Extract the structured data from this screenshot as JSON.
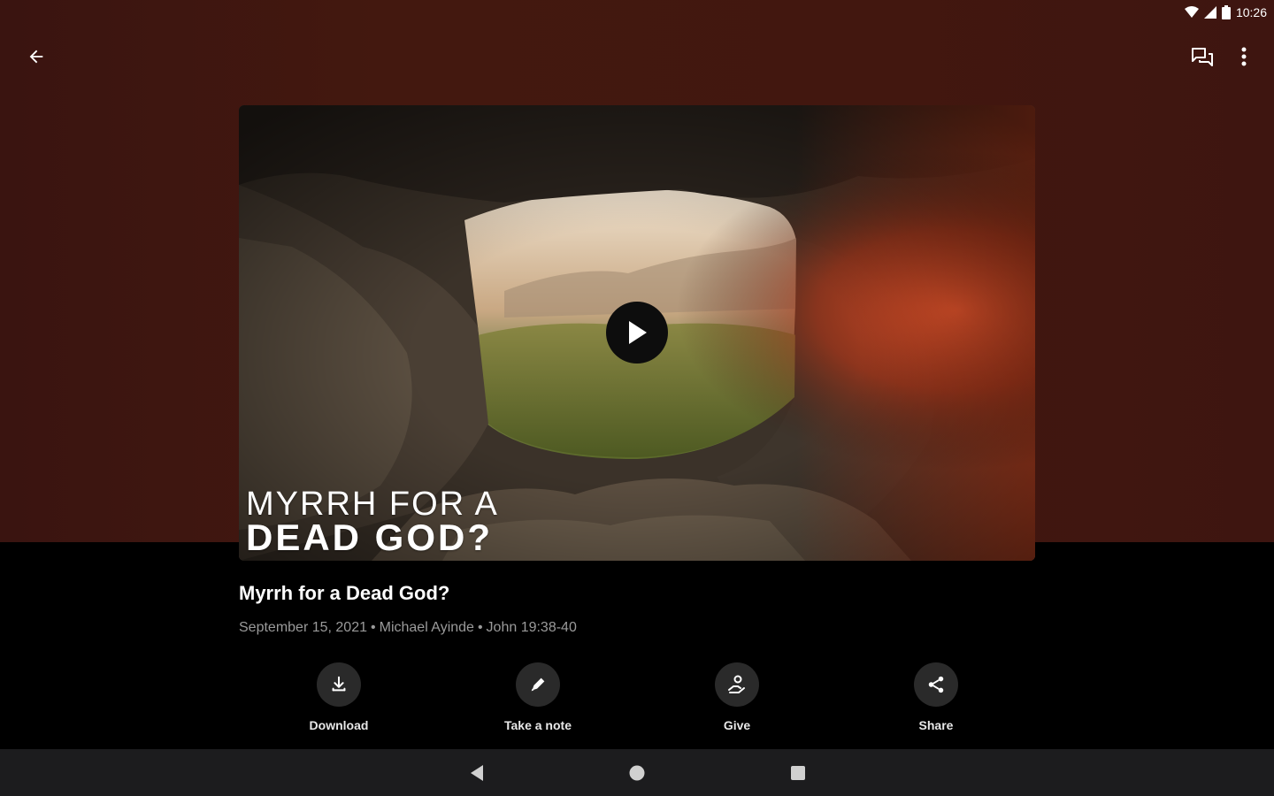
{
  "status_bar": {
    "time": "10:26",
    "wifi_icon": "wifi-icon",
    "signal_icon": "signal-icon",
    "battery_icon": "battery-icon"
  },
  "app_bar": {
    "back_icon": "arrow-left-icon",
    "chat_icon": "chat-bubbles-icon",
    "more_icon": "more-vertical-icon"
  },
  "video": {
    "overlay_line1": "MYRRH FOR A",
    "overlay_line2": "DEAD GOD?",
    "play_icon": "play-icon"
  },
  "sermon": {
    "title": "Myrrh for a Dead God?",
    "date": "September 15, 2021",
    "speaker": "Michael Ayinde",
    "passage": "John 19:38-40",
    "separator": "•"
  },
  "actions": [
    {
      "label": "Download",
      "icon": "download-icon"
    },
    {
      "label": "Take a note",
      "icon": "pencil-icon"
    },
    {
      "label": "Give",
      "icon": "give-hand-icon"
    },
    {
      "label": "Share",
      "icon": "share-icon"
    }
  ],
  "nav_bar": {
    "back": "nav-back-icon",
    "home": "nav-home-icon",
    "recents": "nav-recents-icon"
  },
  "colors": {
    "header_bg": "#42170f",
    "body_bg": "#000000",
    "action_circle": "#2a2a2a",
    "meta_text": "#9a9a9a",
    "nav_bar_bg": "#1c1c1e"
  }
}
